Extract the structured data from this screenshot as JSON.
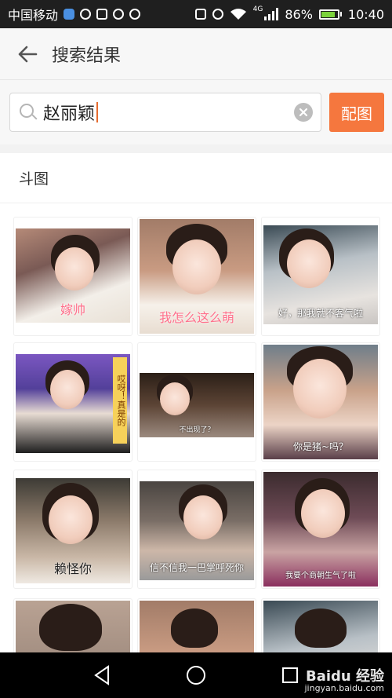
{
  "status_bar": {
    "carrier": "中国移动",
    "battery_pct": "86%",
    "time": "10:40",
    "net": "4G",
    "battery_level": 0.86
  },
  "header": {
    "title": "搜索结果"
  },
  "search": {
    "query": "赵丽颖",
    "action_label": "配图"
  },
  "section": {
    "title": "斗图"
  },
  "results": [
    {
      "caption": "嫁帅"
    },
    {
      "caption": "我怎么这么萌"
    },
    {
      "caption": "好，那我就不客气啦"
    },
    {
      "caption": "哎呀！真是的"
    },
    {
      "caption": "不出现了？"
    },
    {
      "caption": "你是猪~吗？"
    },
    {
      "caption": "赖怪你"
    },
    {
      "caption": "信不信我一巴掌呼死你"
    },
    {
      "caption": "我要个商朝生气了啦"
    },
    {
      "caption": ""
    },
    {
      "caption": ""
    },
    {
      "caption": ""
    }
  ],
  "watermark": {
    "brand": "Baidu 经验",
    "url": "jingyan.baidu.com"
  }
}
